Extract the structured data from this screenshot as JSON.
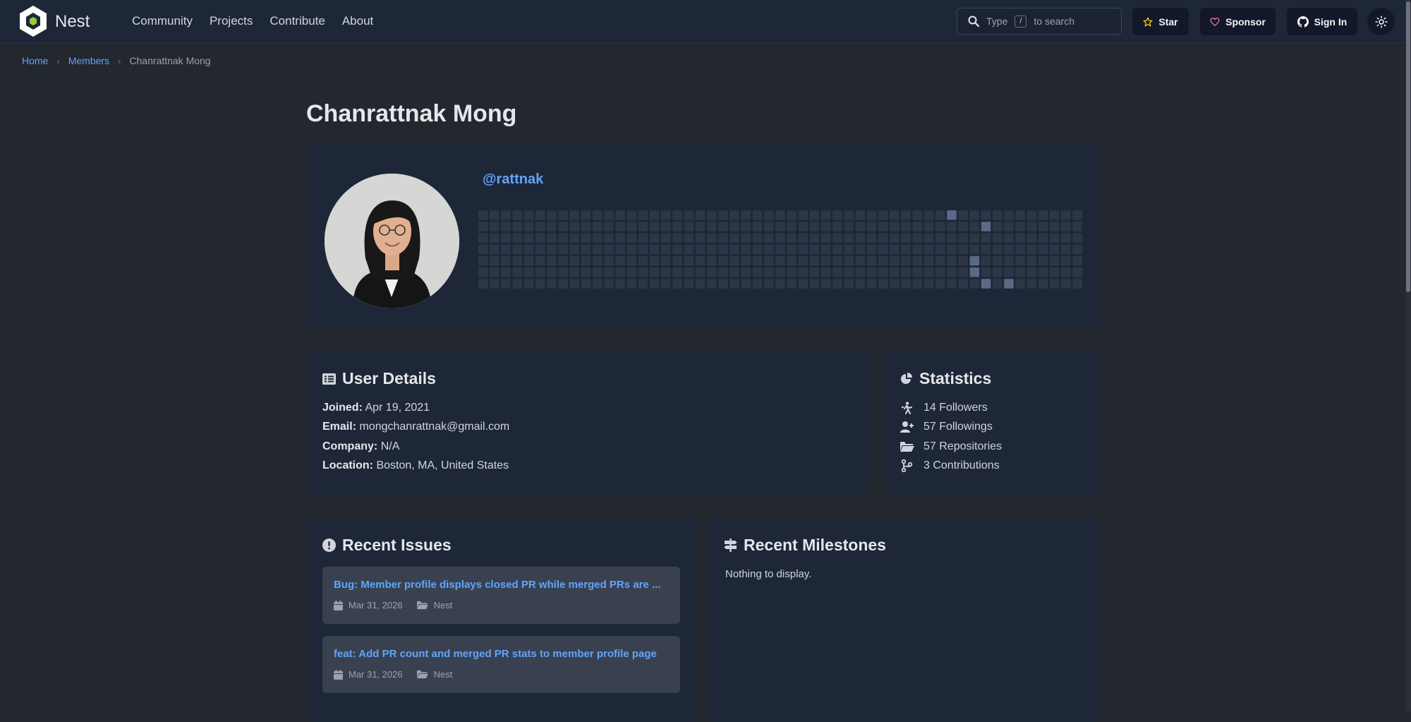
{
  "nav": {
    "brand": "Nest",
    "links": [
      "Community",
      "Projects",
      "Contribute",
      "About"
    ],
    "search": {
      "prefix": "Type",
      "key": "/",
      "suffix": "to search"
    },
    "star_label": "Star",
    "sponsor_label": "Sponsor",
    "signin_label": "Sign In"
  },
  "breadcrumb": [
    "Home",
    "Members",
    "Chanrattnak Mong"
  ],
  "profile": {
    "name": "Chanrattnak Mong",
    "handle": "@rattnak"
  },
  "heatmap": {
    "weeks": 53,
    "days": 7,
    "active": [
      [
        41,
        0
      ],
      [
        44,
        1
      ],
      [
        43,
        4
      ],
      [
        43,
        5
      ],
      [
        44,
        6
      ],
      [
        46,
        6
      ]
    ]
  },
  "user_details": {
    "heading": "User Details",
    "joined_label": "Joined:",
    "joined": "Apr 19, 2021",
    "email_label": "Email:",
    "email": "mongchanrattnak@gmail.com",
    "company_label": "Company:",
    "company": "N/A",
    "location_label": "Location:",
    "location": "Boston, MA, United States"
  },
  "statistics": {
    "heading": "Statistics",
    "followers": "14 Followers",
    "followings": "57 Followings",
    "repositories": "57 Repositories",
    "contributions": "3 Contributions"
  },
  "recent_issues": {
    "heading": "Recent Issues",
    "items": [
      {
        "title": "Bug: Member profile displays closed PR while merged PRs are ...",
        "date": "Mar 31, 2026",
        "repo": "Nest"
      },
      {
        "title": "feat: Add PR count and merged PR stats to member profile page",
        "date": "Mar 31, 2026",
        "repo": "Nest"
      }
    ]
  },
  "recent_milestones": {
    "heading": "Recent Milestones",
    "empty": "Nothing to display."
  }
}
